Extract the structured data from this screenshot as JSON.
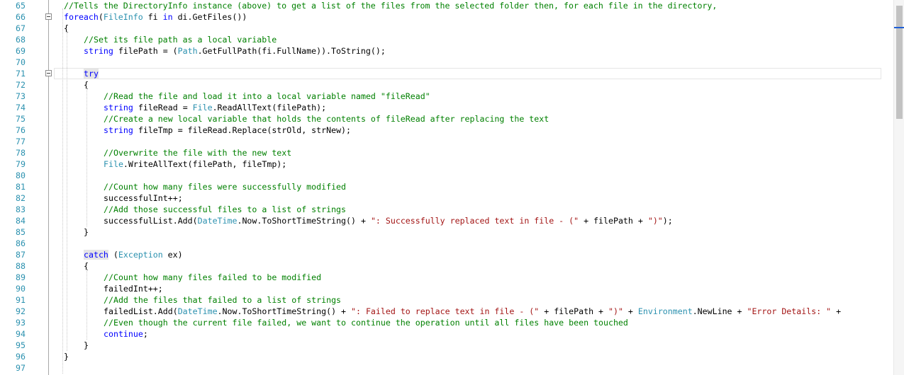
{
  "editor": {
    "line_numbers": [
      "65",
      "66",
      "67",
      "68",
      "69",
      "70",
      "71",
      "72",
      "73",
      "74",
      "75",
      "76",
      "77",
      "78",
      "79",
      "80",
      "81",
      "82",
      "83",
      "84",
      "85",
      "86",
      "87",
      "88",
      "89",
      "90",
      "91",
      "92",
      "93",
      "94",
      "95",
      "96",
      "97"
    ],
    "lines": [
      [
        [
          "cm",
          "//Tells the DirectoryInfo instance (above) to get a list of the files from the selected folder then, for each file in the directory,"
        ]
      ],
      [
        [
          "kw",
          "foreach"
        ],
        [
          "",
          "("
        ],
        [
          "ty",
          "FileInfo"
        ],
        [
          "",
          " fi "
        ],
        [
          "kw",
          "in"
        ],
        [
          "",
          " di.GetFiles())"
        ]
      ],
      [
        [
          "",
          "{"
        ]
      ],
      [
        [
          "cm",
          "//Set its file path as a local variable"
        ]
      ],
      [
        [
          "kw",
          "string"
        ],
        [
          "",
          " filePath = ("
        ],
        [
          "ty",
          "Path"
        ],
        [
          "",
          ".GetFullPath(fi.FullName)).ToString();"
        ]
      ],
      [],
      [
        [
          "kwhl",
          "try"
        ]
      ],
      [
        [
          "",
          "{"
        ]
      ],
      [
        [
          "cm",
          "//Read the file and load it into a local variable named \"fileRead\""
        ]
      ],
      [
        [
          "kw",
          "string"
        ],
        [
          "",
          " fileRead = "
        ],
        [
          "ty",
          "File"
        ],
        [
          "",
          ".ReadAllText(filePath);"
        ]
      ],
      [
        [
          "cm",
          "//Create a new local variable that holds the contents of fileRead after replacing the text"
        ]
      ],
      [
        [
          "kw",
          "string"
        ],
        [
          "",
          " fileTmp = fileRead.Replace(strOld, strNew);"
        ]
      ],
      [],
      [
        [
          "cm",
          "//Overwrite the file with the new text"
        ]
      ],
      [
        [
          "ty",
          "File"
        ],
        [
          "",
          ".WriteAllText(filePath, fileTmp);"
        ]
      ],
      [],
      [
        [
          "cm",
          "//Count how many files were successfully modified"
        ]
      ],
      [
        [
          "",
          "successfulInt++;"
        ]
      ],
      [
        [
          "cm",
          "//Add those successful files to a list of strings"
        ]
      ],
      [
        [
          "",
          "successfulList.Add("
        ],
        [
          "ty",
          "DateTime"
        ],
        [
          "",
          ".Now.ToShortTimeString() + "
        ],
        [
          "st",
          "\": Successfully replaced text in file - (\""
        ],
        [
          "",
          " + filePath + "
        ],
        [
          "st",
          "\")\""
        ],
        [
          "",
          ");"
        ]
      ],
      [
        [
          "",
          "}"
        ]
      ],
      [],
      [
        [
          "kwhl",
          "catch"
        ],
        [
          "",
          " ("
        ],
        [
          "ty",
          "Exception"
        ],
        [
          "",
          " ex)"
        ]
      ],
      [
        [
          "",
          "{"
        ]
      ],
      [
        [
          "cm",
          "//Count how many files failed to be modified"
        ]
      ],
      [
        [
          "",
          "failedInt++;"
        ]
      ],
      [
        [
          "cm",
          "//Add the files that failed to a list of strings"
        ]
      ],
      [
        [
          "",
          "failedList.Add("
        ],
        [
          "ty",
          "DateTime"
        ],
        [
          "",
          ".Now.ToShortTimeString() + "
        ],
        [
          "st",
          "\": Failed to replace text in file - (\""
        ],
        [
          "",
          " + filePath + "
        ],
        [
          "st",
          "\")\""
        ],
        [
          "",
          " + "
        ],
        [
          "ty",
          "Environment"
        ],
        [
          "",
          ".NewLine + "
        ],
        [
          "st",
          "\"Error Details: \""
        ],
        [
          "",
          " +"
        ]
      ],
      [
        [
          "cm",
          "//Even though the current file failed, we want to continue the operation until all files have been touched"
        ]
      ],
      [
        [
          "kw",
          "continue"
        ],
        [
          "",
          ";"
        ]
      ],
      [
        [
          "",
          "}"
        ]
      ],
      [
        [
          "",
          "}"
        ]
      ],
      []
    ],
    "colors": {
      "keyword": "#0000ff",
      "type": "#2b91af",
      "comment": "#008000",
      "string": "#a31515",
      "line_number": "#2b91af"
    }
  }
}
